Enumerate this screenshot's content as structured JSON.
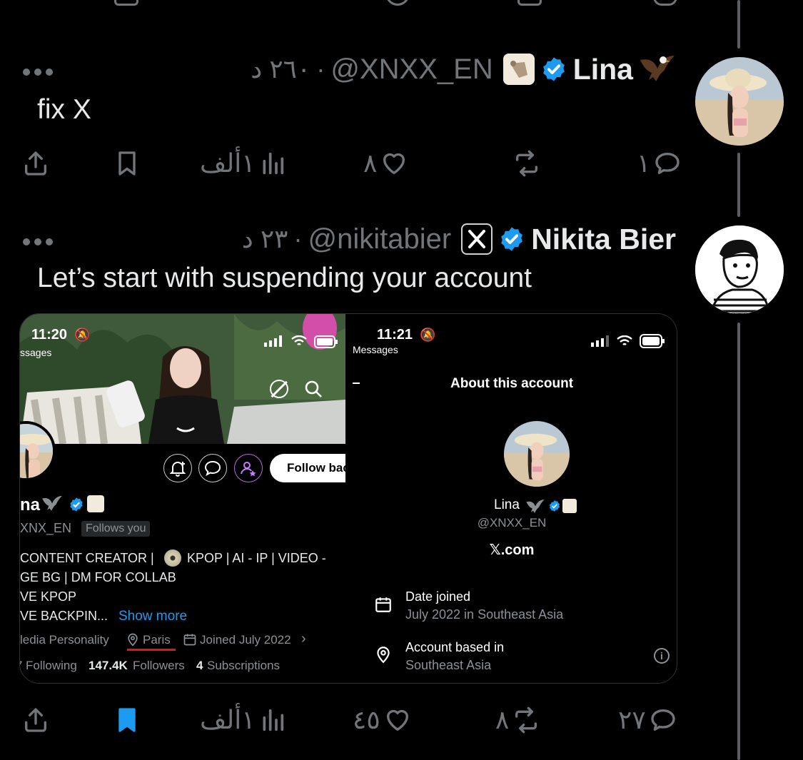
{
  "colors": {
    "background": "#000000",
    "text": "#e7e9ea",
    "muted": "#71767b",
    "verified_blue": "#1d9bf0",
    "bookmark_active": "#1d9bf0",
    "divider": "#2f3336",
    "underline_red": "#e0181e"
  },
  "tweet1": {
    "name": "Lina",
    "name_emoji_icon": "eagle-icon",
    "affiliate_icon": "foot-badge-icon",
    "handle": "@XNXX_EN",
    "dot": "·",
    "time": "٢٦٠ د",
    "text": "fix X",
    "actions": {
      "replies": "١",
      "reposts": "",
      "likes": "٨",
      "views": "١ألف"
    }
  },
  "tweet2": {
    "name": "Nikita Bier",
    "affiliate_icon": "x-logo-badge-icon",
    "handle": "@nikitabier",
    "dot": "·",
    "time": "٢٣ د",
    "text": "Let’s start with suspending your account",
    "actions": {
      "replies": "٢٧",
      "reposts": "٨",
      "likes": "٤٥",
      "views": "١ألف"
    },
    "bookmarked": true
  },
  "screenshot_left": {
    "time": "11:20",
    "back_label": "ssages",
    "follow_button": "Follow bac",
    "name": "na",
    "handle": "XNX_EN",
    "follows_you": "Follows you",
    "bio_lines": [
      "CONTENT CREATOR |",
      "KPOP | AI - IP | VIDEO -",
      "GE BG | DM FOR COLLAB",
      "VE KPOP",
      "VE BACKPIN..."
    ],
    "show_more": "Show more",
    "category": "ledia Personality",
    "location": "Paris",
    "joined": "Joined July 2022",
    "following_label": "Following",
    "following_count": "7",
    "followers_count": "147.4K",
    "followers_label": "Followers",
    "subs_count": "4",
    "subs_label": "Subscriptions"
  },
  "screenshot_right": {
    "time": "11:21",
    "back_label": "Messages",
    "title": "About this account",
    "name": "Lina",
    "handle": "@XNXX_EN",
    "site": "𝕏.com",
    "date_joined_label": "Date joined",
    "date_joined_value": "July 2022 in Southeast Asia",
    "based_label": "Account based in",
    "based_value": "Southeast Asia"
  }
}
